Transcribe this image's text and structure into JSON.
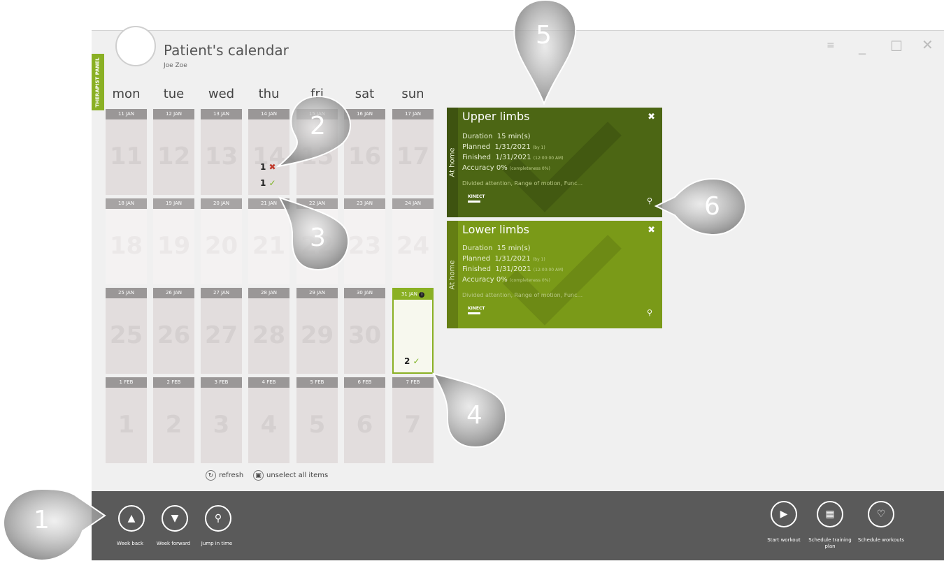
{
  "header": {
    "title": "Patient's calendar",
    "patient": "Joe Zoe",
    "panel_tab": "THERAPIST PANEL"
  },
  "window": {
    "min_icon": "minimize-icon",
    "max_icon": "maximize-icon",
    "close_icon": "close-icon",
    "settings_icon": "settings-icon"
  },
  "days": [
    "mon",
    "tue",
    "wed",
    "thu",
    "fri",
    "sat",
    "sun"
  ],
  "weeks": [
    {
      "dates": [
        "11 JAN",
        "12 JAN",
        "13 JAN",
        "14 JAN",
        "15 JAN",
        "16 JAN",
        "17 JAN"
      ],
      "nums": [
        "11",
        "12",
        "13",
        "14",
        "15",
        "16",
        "17"
      ]
    },
    {
      "dates": [
        "18 JAN",
        "19 JAN",
        "20 JAN",
        "21 JAN",
        "22 JAN",
        "23 JAN",
        "24 JAN"
      ],
      "nums": [
        "18",
        "19",
        "20",
        "21",
        "22",
        "23",
        "24"
      ]
    },
    {
      "dates": [
        "25 JAN",
        "26 JAN",
        "27 JAN",
        "28 JAN",
        "29 JAN",
        "30 JAN",
        "31 JAN"
      ],
      "nums": [
        "25",
        "26",
        "27",
        "28",
        "29",
        "30",
        "31"
      ]
    },
    {
      "dates": [
        "1 FEB",
        "2 FEB",
        "3 FEB",
        "4 FEB",
        "5 FEB",
        "6 FEB",
        "7 FEB"
      ],
      "nums": [
        "1",
        "2",
        "3",
        "4",
        "5",
        "6",
        "7"
      ]
    }
  ],
  "marks": {
    "thu_fail": "1",
    "thu_ok": "1",
    "sun31_ok": "2"
  },
  "cards": [
    {
      "title": "Upper limbs",
      "location": "At home",
      "duration_label": "Duration",
      "duration": "15 min(s)",
      "planned_label": "Planned",
      "planned": "1/31/2021",
      "planned_by": "(by 1)",
      "finished_label": "Finished",
      "finished": "1/31/2021",
      "finished_time": "(12:00:00 AM)",
      "accuracy_label": "Accuracy",
      "accuracy": "0%",
      "completeness": "(completeness 0%)",
      "tags": "Divided attention, Range of motion, Func...",
      "device": "KINECT",
      "color": "#4c6614"
    },
    {
      "title": "Lower limbs",
      "location": "At home",
      "duration_label": "Duration",
      "duration": "15 min(s)",
      "planned_label": "Planned",
      "planned": "1/31/2021",
      "planned_by": "(by 1)",
      "finished_label": "Finished",
      "finished": "1/31/2021",
      "finished_time": "(12:00:00 AM)",
      "accuracy_label": "Accuracy",
      "accuracy": "0%",
      "completeness": "(completeness 0%)",
      "tags": "Divided attention, Range of motion, Func...",
      "device": "KINECT",
      "color": "#7a9a18"
    }
  ],
  "actions": {
    "refresh": "refresh",
    "unselect": "unselect all items"
  },
  "toolbar": {
    "week_back": "Week back",
    "week_forward": "Week forward",
    "jump": "Jump in time",
    "start": "Start workout",
    "schedule_plan": "Schedule training plan",
    "schedule_workouts": "Schedule workouts"
  },
  "callouts": [
    "1",
    "2",
    "3",
    "4",
    "5",
    "6"
  ]
}
